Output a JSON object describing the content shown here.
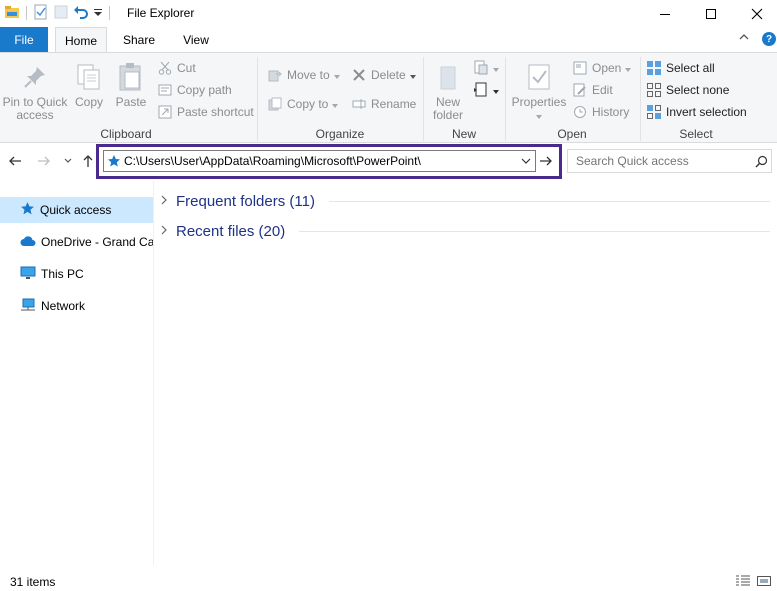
{
  "window": {
    "title": "File Explorer"
  },
  "tabs": {
    "file": "File",
    "home": "Home",
    "share": "Share",
    "view": "View"
  },
  "ribbon": {
    "clipboard": {
      "label": "Clipboard",
      "pin": "Pin to Quick access",
      "copy": "Copy",
      "paste": "Paste",
      "cut": "Cut",
      "copy_path": "Copy path",
      "paste_shortcut": "Paste shortcut"
    },
    "organize": {
      "label": "Organize",
      "move_to": "Move to",
      "copy_to": "Copy to",
      "delete": "Delete",
      "rename": "Rename"
    },
    "new": {
      "label": "New",
      "new_folder": "New folder"
    },
    "open": {
      "label": "Open",
      "properties": "Properties",
      "open": "Open",
      "edit": "Edit",
      "history": "History"
    },
    "select": {
      "label": "Select",
      "select_all": "Select all",
      "select_none": "Select none",
      "invert_selection": "Invert selection"
    }
  },
  "address_bar": {
    "path": "C:\\Users\\User\\AppData\\Roaming\\Microsoft\\PowerPoint\\"
  },
  "search": {
    "placeholder": "Search Quick access"
  },
  "nav_pane": {
    "items": [
      {
        "label": "Quick access",
        "icon": "star-icon",
        "selected": true
      },
      {
        "label": "OneDrive - Grand Canyon University",
        "icon": "cloud-icon"
      },
      {
        "label": "This PC",
        "icon": "monitor-icon"
      },
      {
        "label": "Network",
        "icon": "network-icon"
      }
    ]
  },
  "content": {
    "frequent_folders": "Frequent folders (11)",
    "recent_files": "Recent files (20)"
  },
  "status": {
    "items_count": "31 items"
  },
  "colors": {
    "accent": "#1979ca",
    "highlight_border": "#4b2a8f",
    "selected_nav": "#cce8ff",
    "section_header": "#1e3287"
  }
}
